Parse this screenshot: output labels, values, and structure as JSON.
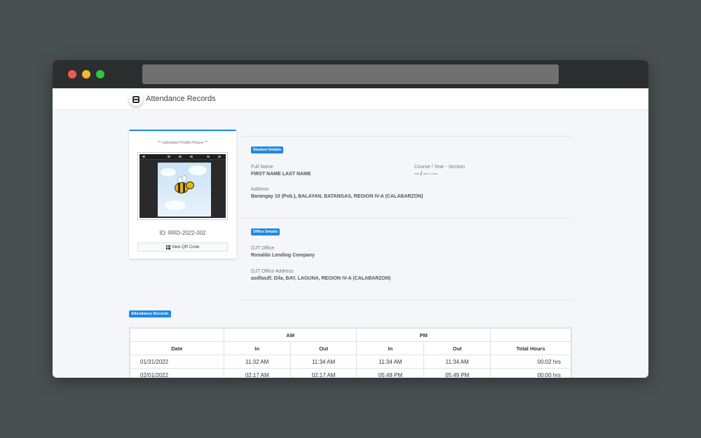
{
  "app": {
    "title": "Attendance Records"
  },
  "profile": {
    "caption": "** Uploaded Profile Picture **",
    "id_text": "ID: RRD-2022-002",
    "qr_button_label": "View QR Code"
  },
  "student": {
    "badge": "Student Details",
    "full_name_label": "Full Name",
    "full_name": "FIRST NAME LAST NAME",
    "course_label": "Course / Year - Section",
    "course_value": "--- / --- - ---",
    "address_label": "Address",
    "address": "Barangay 10 (Pob.), BALAYAN, BATANGAS, REGION IV-A (CALABARZON)"
  },
  "office": {
    "badge": "Office Details",
    "office_label": "OJT Office",
    "office_name": "Ronaldo Lending Company",
    "office_address_label": "OJT Office Address",
    "office_address": "asdfasdf, Dila, BAY, LAGUNA, REGION IV-A (CALABARZON)"
  },
  "attendance": {
    "badge": "Attendance Records",
    "groups": {
      "am": "AM",
      "pm": "PM"
    },
    "columns": [
      "Date",
      "In",
      "Out",
      "In",
      "Out",
      "Total Hours"
    ],
    "rows": [
      {
        "date": "01/31/2022",
        "am_in": "11:32 AM",
        "am_out": "11:34 AM",
        "pm_in": "11:34 AM",
        "pm_out": "11:34 AM",
        "total": "00:02 hrs"
      },
      {
        "date": "02/01/2022",
        "am_in": "02:17 AM",
        "am_out": "02:17 AM",
        "pm_in": "05:48 PM",
        "pm_out": "05:49 PM",
        "total": "00:00 hrs"
      }
    ]
  },
  "colors": {
    "accent": "#1e88e5",
    "titlebar": "#2b2d2f",
    "page_bg": "#f4f6f9"
  }
}
